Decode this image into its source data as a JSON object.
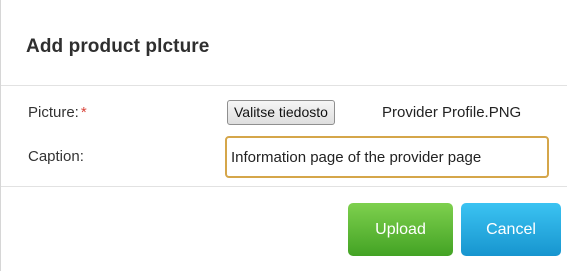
{
  "dialog": {
    "title": "Add product plcture"
  },
  "form": {
    "picture_label": "Picture:",
    "required_marker": "*",
    "choose_file_label": "Valitse tiedosto",
    "file_name": "Provider Profile.PNG",
    "caption_label": "Caption:",
    "caption_value": "Information page of the provider page"
  },
  "buttons": {
    "upload_label": "Upload",
    "cancel_label": "Cancel"
  },
  "colors": {
    "required": "#d9443a",
    "input_focus_border": "#d5a64a",
    "upload_button": "#5cba36",
    "cancel_button": "#23abe3"
  }
}
